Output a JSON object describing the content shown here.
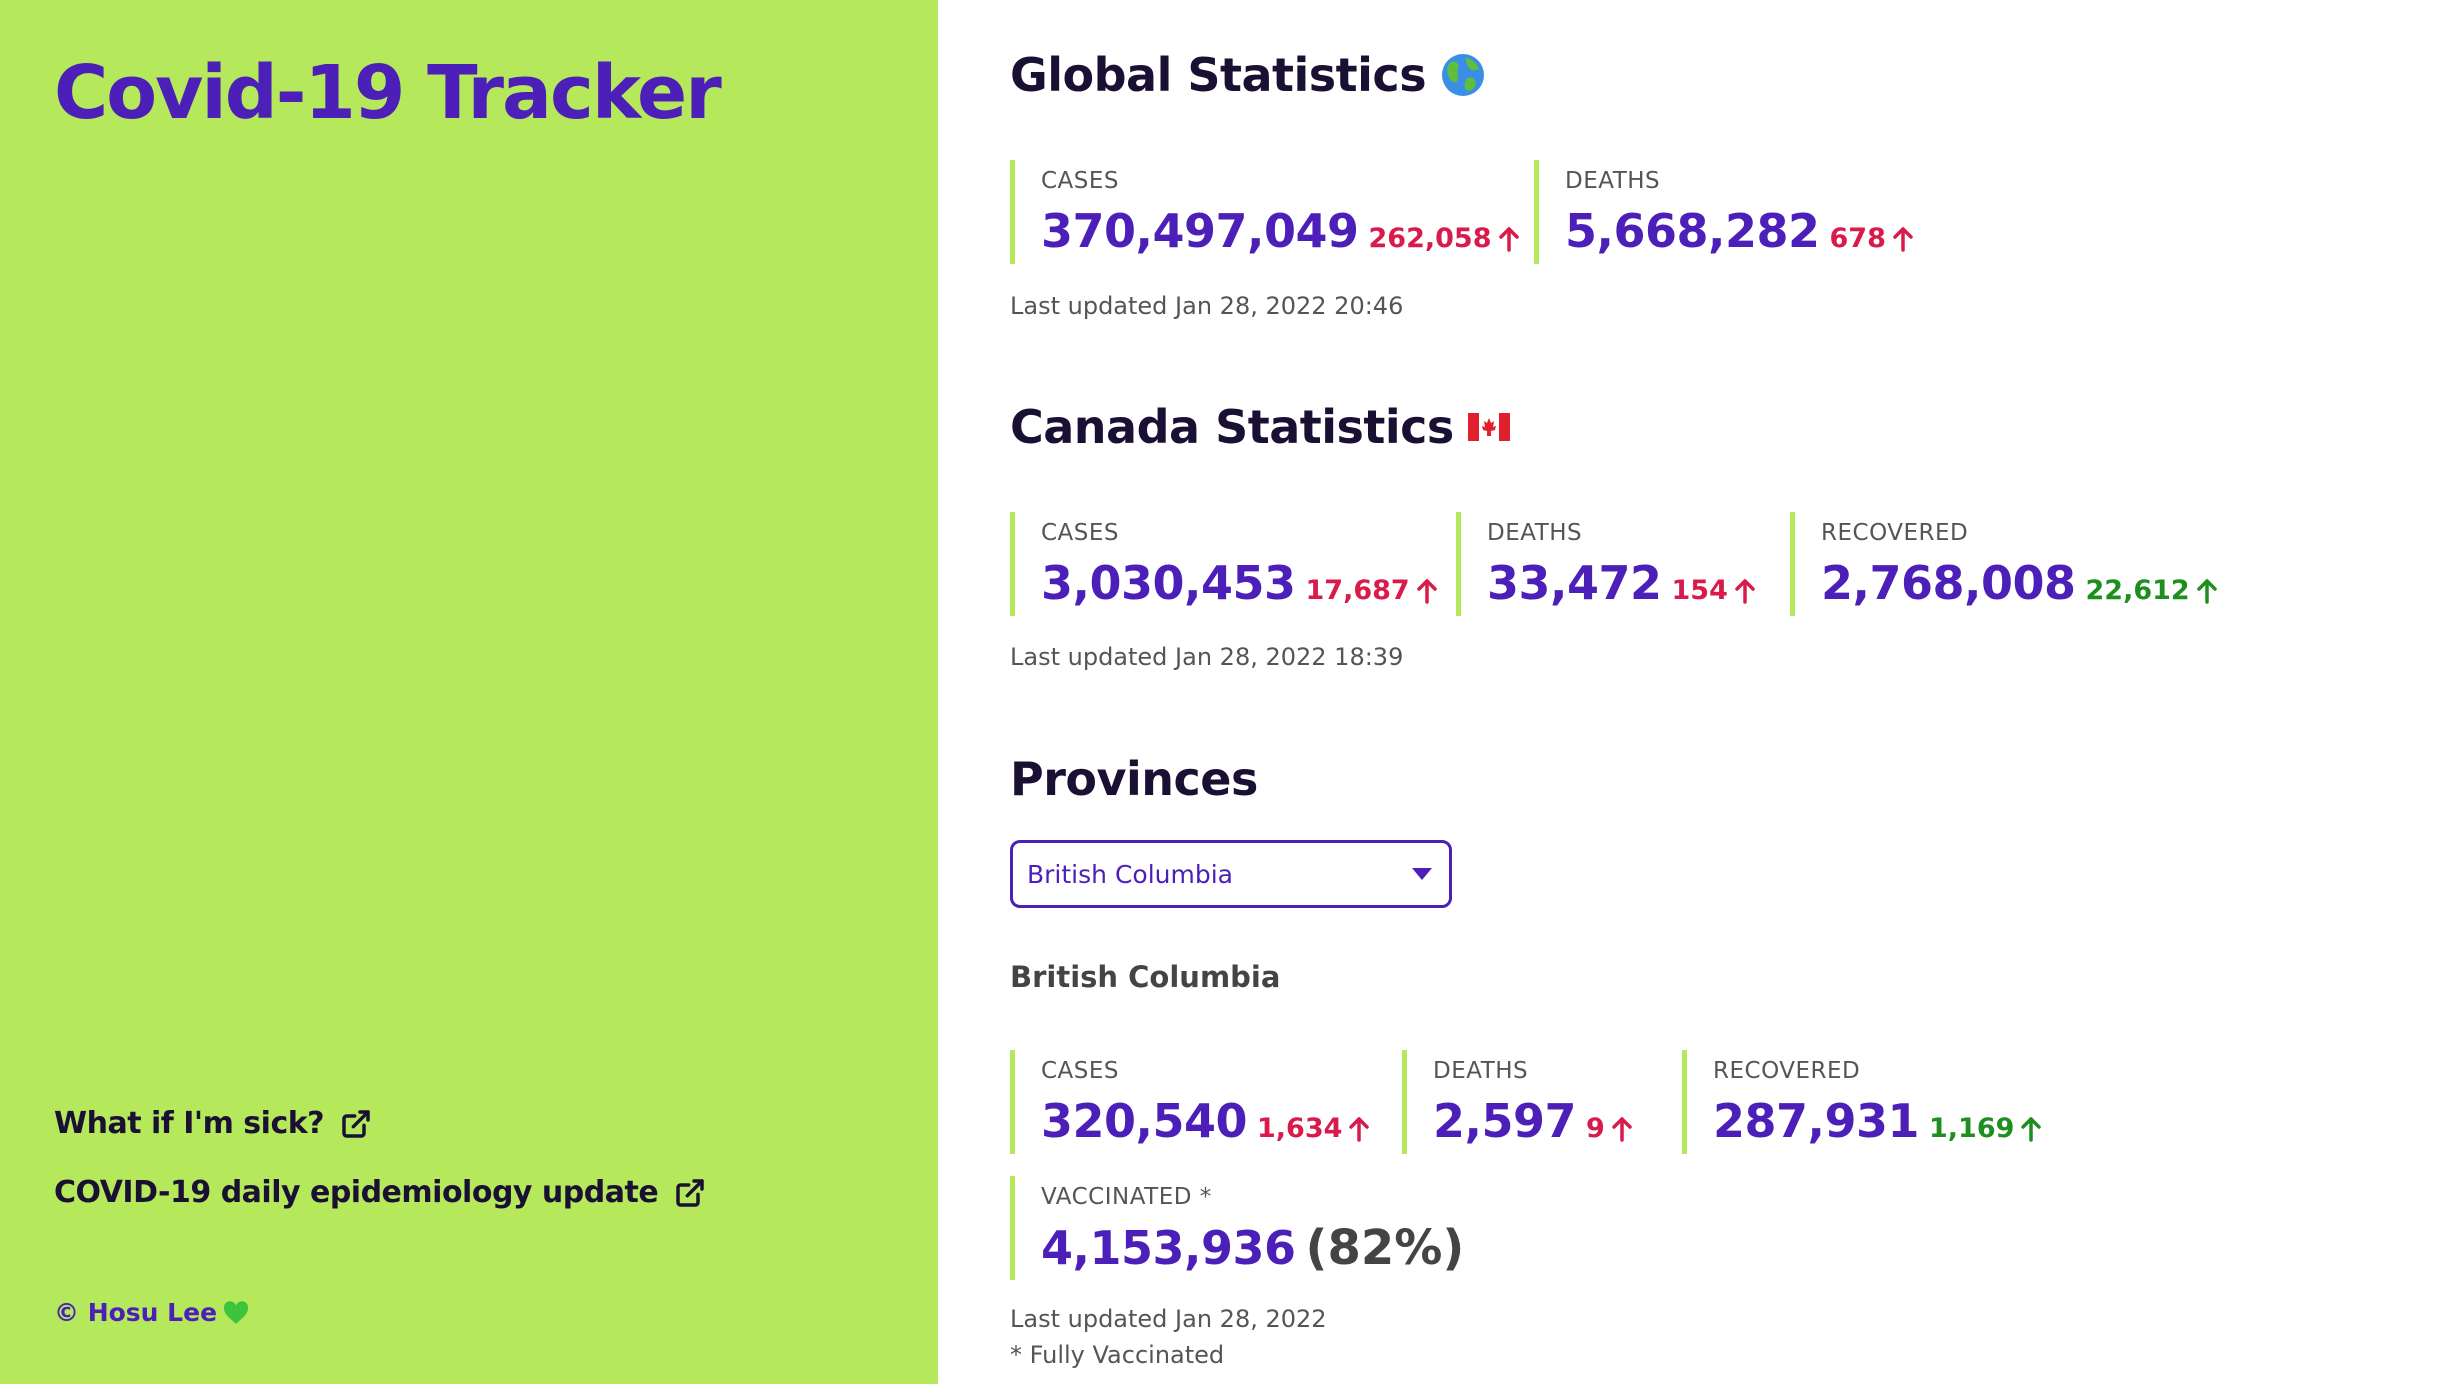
{
  "app": {
    "title": "Covid-19 Tracker",
    "links": [
      {
        "label": "What if I'm sick?"
      },
      {
        "label": "COVID-19 daily epidemiology update"
      }
    ],
    "copyright": "© Hosu Lee"
  },
  "colors": {
    "sidebar_bg": "#b5e85a",
    "accent": "#4b1fb8",
    "increase_red": "#d81b4a",
    "increase_green": "#1e8f1e"
  },
  "global": {
    "title": "Global Statistics",
    "title_icon": "globe-icon",
    "cases": {
      "label": "CASES",
      "value": "370,497,049",
      "delta": "262,058"
    },
    "deaths": {
      "label": "DEATHS",
      "value": "5,668,282",
      "delta": "678"
    },
    "updated": "Last updated Jan 28, 2022 20:46"
  },
  "canada": {
    "title": "Canada Statistics",
    "title_icon": "canada-flag-icon",
    "cases": {
      "label": "CASES",
      "value": "3,030,453",
      "delta": "17,687"
    },
    "deaths": {
      "label": "DEATHS",
      "value": "33,472",
      "delta": "154"
    },
    "recovered": {
      "label": "RECOVERED",
      "value": "2,768,008",
      "delta": "22,612"
    },
    "updated": "Last updated Jan 28, 2022 18:39"
  },
  "provinces": {
    "title": "Provinces",
    "selected": "British Columbia",
    "name": "British Columbia",
    "cases": {
      "label": "CASES",
      "value": "320,540",
      "delta": "1,634"
    },
    "deaths": {
      "label": "DEATHS",
      "value": "2,597",
      "delta": "9"
    },
    "recovered": {
      "label": "RECOVERED",
      "value": "287,931",
      "delta": "1,169"
    },
    "vaccinated": {
      "label": "VACCINATED *",
      "value": "4,153,936",
      "percent": "(82%)"
    },
    "updated": "Last updated Jan 28, 2022",
    "footnote": "* Fully Vaccinated"
  }
}
